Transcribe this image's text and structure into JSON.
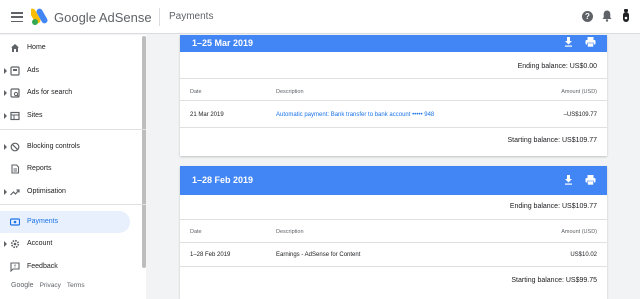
{
  "header": {
    "brand_google": "Google",
    "brand_product": "AdSense",
    "page_title": "Payments",
    "help_glyph": "?"
  },
  "sidebar": {
    "items": [
      {
        "label": "Home"
      },
      {
        "label": "Ads"
      },
      {
        "label": "Ads for search"
      },
      {
        "label": "Sites"
      },
      {
        "label": "Blocking controls"
      },
      {
        "label": "Reports"
      },
      {
        "label": "Optimisation"
      },
      {
        "label": "Payments"
      },
      {
        "label": "Account"
      },
      {
        "label": "Feedback"
      }
    ],
    "active_item": "Payments",
    "footer": {
      "google": "Google",
      "privacy": "Privacy",
      "terms": "Terms"
    }
  },
  "colors": {
    "accent": "#4285f4",
    "link": "#1a73e8",
    "active_bg": "#e8f0fe"
  },
  "statements": [
    {
      "period": "1–25 Mar 2019",
      "ending_balance": "Ending balance: US$0.00",
      "columns": {
        "date": "Date",
        "description": "Description",
        "amount": "Amount (USD)"
      },
      "row": {
        "date": "21 Mar 2019",
        "description": "Automatic payment: Bank transfer to bank account ••••• 948",
        "amount": "–US$109.77"
      },
      "starting_balance": "Starting balance: US$109.77"
    },
    {
      "period": "1–28 Feb 2019",
      "ending_balance": "Ending balance: US$109.77",
      "columns": {
        "date": "Date",
        "description": "Description",
        "amount": "Amount (USD)"
      },
      "row": {
        "date": "1–28 Feb 2019",
        "description": "Earnings - AdSense for Content",
        "amount": "US$10.02"
      },
      "starting_balance": "Starting balance: US$99.75"
    }
  ]
}
